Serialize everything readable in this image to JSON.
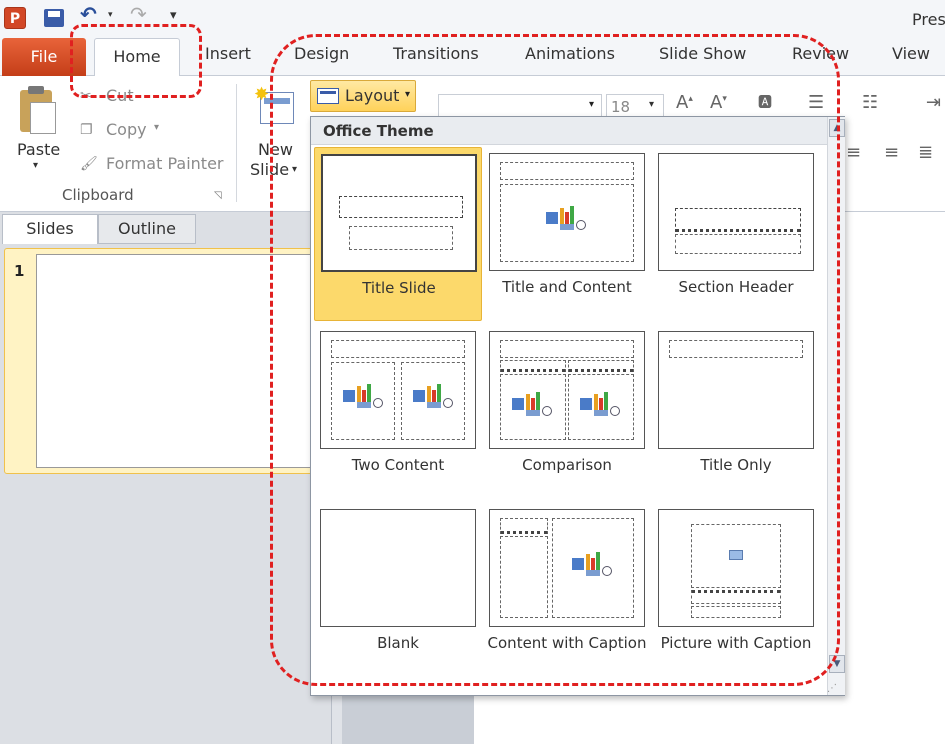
{
  "window": {
    "title": "Pres"
  },
  "app_icon": "P",
  "tabs": [
    "File",
    "Home",
    "Insert",
    "Design",
    "Transitions",
    "Animations",
    "Slide Show",
    "Review",
    "View"
  ],
  "clipboard": {
    "paste": "Paste",
    "cut": "Cut",
    "copy": "Copy",
    "format_painter": "Format Painter",
    "group_label": "Clipboard"
  },
  "slides": {
    "new_slide_line1": "New",
    "new_slide_line2": "Slide",
    "layout_label": "Layout"
  },
  "font": {
    "size": "18"
  },
  "panel_tabs": [
    "Slides",
    "Outline"
  ],
  "slide_number": "1",
  "gallery": {
    "header": "Office Theme",
    "items": [
      {
        "label": "Title Slide"
      },
      {
        "label": "Title and Content"
      },
      {
        "label": "Section Header"
      },
      {
        "label": "Two Content"
      },
      {
        "label": "Comparison"
      },
      {
        "label": "Title Only"
      },
      {
        "label": "Blank"
      },
      {
        "label": "Content with Caption"
      },
      {
        "label": "Picture with Caption"
      }
    ]
  },
  "colors": {
    "file_tab": "#d24726",
    "selection": "#fcd96b",
    "annotation": "#e02020"
  }
}
